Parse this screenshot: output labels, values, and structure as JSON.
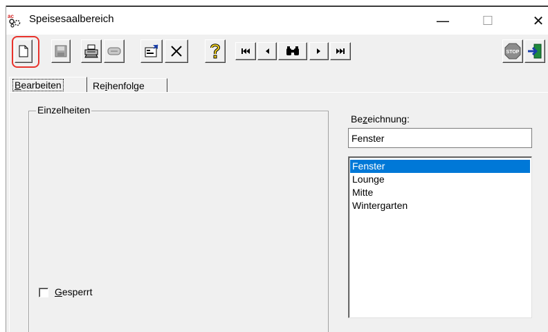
{
  "window": {
    "title": "Speisesaalbereich",
    "controls": {
      "minimize": "—",
      "maximize": "☐",
      "close": "✕"
    }
  },
  "toolbar": {
    "buttons": [
      {
        "name": "new-document",
        "icon": "new-document-icon",
        "highlighted": true
      },
      {
        "name": "save",
        "icon": "save-disk-icon"
      },
      {
        "name": "print",
        "icon": "printer-icon"
      },
      {
        "name": "printer-tray",
        "icon": "tray-icon"
      },
      {
        "name": "properties",
        "icon": "properties-icon"
      },
      {
        "name": "delete",
        "icon": "close-x-icon"
      },
      {
        "name": "help",
        "icon": "question-mark-icon"
      },
      {
        "name": "first-record",
        "icon": "first-record-icon"
      },
      {
        "name": "previous-record",
        "icon": "previous-record-icon"
      },
      {
        "name": "find",
        "icon": "binoculars-icon"
      },
      {
        "name": "next-record",
        "icon": "next-record-icon"
      },
      {
        "name": "last-record",
        "icon": "last-record-icon"
      },
      {
        "name": "stop",
        "icon": "stop-sign-icon",
        "label": "STOP"
      },
      {
        "name": "exit",
        "icon": "exit-door-icon"
      }
    ],
    "highlight_color": "#e8322b"
  },
  "tabs": {
    "active": {
      "label_pre": "",
      "label_u": "B",
      "label_post": "earbeiten"
    },
    "inactive": {
      "label_pre": "Re",
      "label_u": "i",
      "label_post": "henfolge"
    }
  },
  "details": {
    "group_title": "Einzelheiten",
    "gesperrt": {
      "label_u": "G",
      "label_post": "esperrt",
      "checked": false
    }
  },
  "bezeichnung": {
    "label_pre": "Be",
    "label_u": "z",
    "label_post": "eichnung:",
    "value": "Fenster"
  },
  "list": {
    "items": [
      "Fenster",
      "Lounge",
      "Mitte",
      "Wintergarten"
    ],
    "selected_index": 0,
    "selection_color": "#0078d7"
  }
}
